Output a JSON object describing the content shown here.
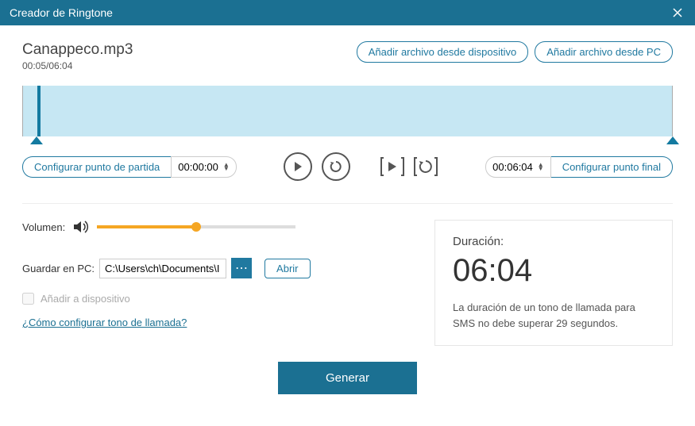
{
  "window": {
    "title": "Creador de Ringtone"
  },
  "file": {
    "name": "Canappeco.mp3",
    "time": "00:05/06:04"
  },
  "buttons": {
    "add_from_device": "Añadir archivo desde dispositivo",
    "add_from_pc": "Añadir archivo desde PC",
    "set_start": "Configurar punto de partida",
    "set_end": "Configurar punto final",
    "open": "Abrir",
    "generate": "Generar"
  },
  "times": {
    "start": "00:00:00",
    "end": "00:06:04"
  },
  "volume": {
    "label": "Volumen:"
  },
  "save": {
    "label": "Guardar en PC:",
    "path": "C:\\Users\\ch\\Documents\\I"
  },
  "checkbox": {
    "add_to_device": "Añadir a dispositivo"
  },
  "link": {
    "howto": "¿Cómo configurar tono de llamada?"
  },
  "duration": {
    "label": "Duración:",
    "value": "06:04",
    "note": "La duración de un tono de llamada para SMS no debe superar 29 segundos."
  }
}
